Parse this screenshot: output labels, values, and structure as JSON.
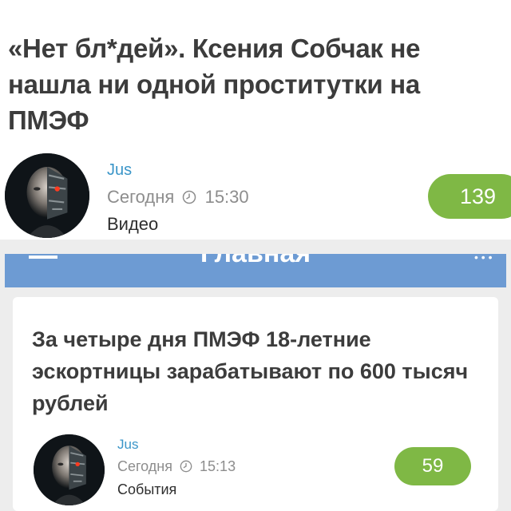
{
  "post1": {
    "title": "«Нет бл*дей». Ксения Собчак не нашла ни одной проститутки на ПМЭФ",
    "author": "Jus",
    "date": "Сегодня",
    "time": "15:30",
    "category": "Видео",
    "comments": "139"
  },
  "nav": {
    "title": "Главная"
  },
  "post2": {
    "title": "За четыре дня ПМЭФ 18-летние эскортницы зарабатывают по 600 тысяч рублей",
    "author": "Jus",
    "date": "Сегодня",
    "time": "15:13",
    "category": "События",
    "comments": "59"
  },
  "colors": {
    "accent_green": "#7fb845",
    "author_blue": "#3a95c8",
    "navbar_blue": "#6d9bd3"
  },
  "icons": [
    "clock-icon",
    "menu-icon",
    "more-icon",
    "avatar-image"
  ]
}
